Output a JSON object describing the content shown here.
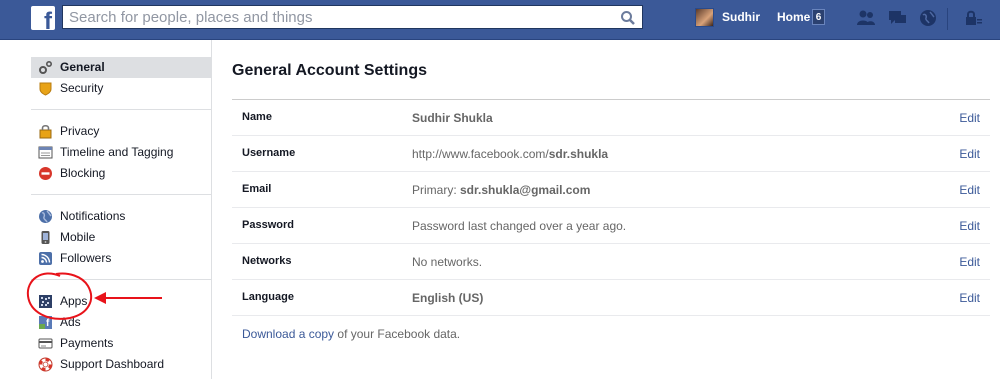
{
  "topbar": {
    "logo_text": "f",
    "search_placeholder": "Search for people, places and things",
    "user_name": "Sudhir",
    "home_label": "Home",
    "home_count": "6",
    "icons": [
      "friend-requests-icon",
      "messages-icon",
      "notifications-icon",
      "privacy-shortcuts-icon"
    ]
  },
  "leftnav": {
    "groups": [
      [
        {
          "label": "General",
          "icon": "gears-icon",
          "selected": true
        },
        {
          "label": "Security",
          "icon": "badge-icon"
        }
      ],
      [
        {
          "label": "Privacy",
          "icon": "lock-icon"
        },
        {
          "label": "Timeline and Tagging",
          "icon": "timeline-icon"
        },
        {
          "label": "Blocking",
          "icon": "block-icon"
        }
      ],
      [
        {
          "label": "Notifications",
          "icon": "globe-icon"
        },
        {
          "label": "Mobile",
          "icon": "mobile-icon"
        },
        {
          "label": "Followers",
          "icon": "rss-icon"
        }
      ],
      [
        {
          "label": "Apps",
          "icon": "apps-icon"
        },
        {
          "label": "Ads",
          "icon": "ads-icon"
        },
        {
          "label": "Payments",
          "icon": "credit-card-icon"
        },
        {
          "label": "Support Dashboard",
          "icon": "lifebuoy-icon"
        }
      ]
    ]
  },
  "main": {
    "title": "General Account Settings",
    "rows": [
      {
        "label": "Name",
        "value_plain": "",
        "value_bold": "Sudhir Shukla",
        "edit": "Edit"
      },
      {
        "label": "Username",
        "value_plain": "http://www.facebook.com/",
        "value_bold": "sdr.shukla",
        "edit": "Edit"
      },
      {
        "label": "Email",
        "value_plain": "Primary: ",
        "value_bold": "sdr.shukla@gmail.com",
        "edit": "Edit"
      },
      {
        "label": "Password",
        "value_plain": "Password last changed over a year ago.",
        "value_bold": "",
        "edit": "Edit"
      },
      {
        "label": "Networks",
        "value_plain": "No networks.",
        "value_bold": "",
        "edit": "Edit"
      },
      {
        "label": "Language",
        "value_plain": "",
        "value_bold": "English (US)",
        "edit": "Edit"
      }
    ],
    "download_link": "Download a copy",
    "download_suffix": " of your Facebook data."
  },
  "colors": {
    "brand": "#3b5998",
    "annotation": "#e8131a"
  }
}
